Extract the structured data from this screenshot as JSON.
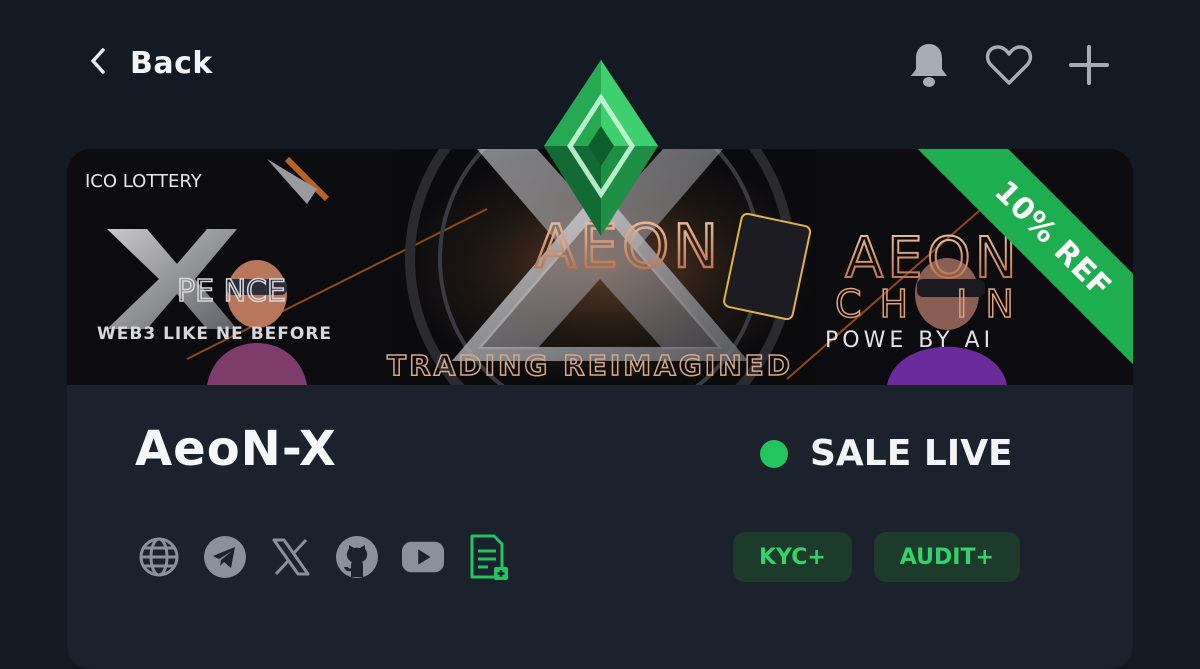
{
  "nav": {
    "back_label": "Back"
  },
  "banner": {
    "top_left_text": "ICO LOTTERY",
    "left_text": "WEB3 LIKE NE BEFORE",
    "left_brand": "PE NCE",
    "center_brand": "AEON",
    "center_tagline": "TRADING REIMAGINED",
    "right_brand": "AEON",
    "right_sub": "CH IN",
    "right_tagline": "POWE BY AI",
    "ribbon": "10% REF"
  },
  "project": {
    "name": "AeoN-X",
    "status": "SALE LIVE",
    "status_color": "#22c55e"
  },
  "socials": [
    {
      "icon": "globe-icon"
    },
    {
      "icon": "telegram-icon"
    },
    {
      "icon": "x-icon"
    },
    {
      "icon": "github-icon"
    },
    {
      "icon": "youtube-icon"
    },
    {
      "icon": "document-add-icon"
    }
  ],
  "badges": {
    "kyc": "KYC+",
    "audit": "AUDIT+"
  },
  "colors": {
    "background": "#141a24",
    "card": "#1b212d",
    "accent_green": "#1fae4f",
    "badge_bg": "#1c3b2b",
    "badge_text": "#33d26a"
  }
}
